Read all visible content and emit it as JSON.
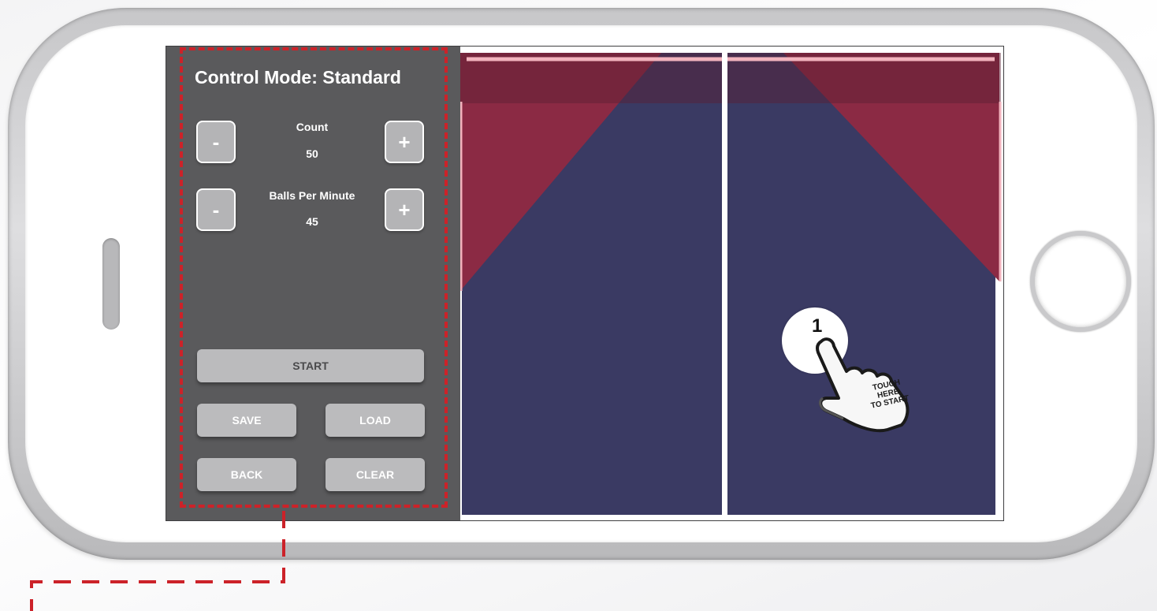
{
  "panel": {
    "mode_title": "Control Mode: Standard",
    "count": {
      "label": "Count",
      "value": "50",
      "minus": "-",
      "plus": "+"
    },
    "balls_per_minute": {
      "label": "Balls Per Minute",
      "value": "45",
      "minus": "-",
      "plus": "+"
    },
    "buttons": {
      "start": "START",
      "save": "SAVE",
      "load": "LOAD",
      "back": "BACK",
      "clear": "CLEAR"
    }
  },
  "hint": {
    "step": "1",
    "line1": "TOUCH",
    "line2": "HERE",
    "line3": "TO START"
  },
  "colors": {
    "table_blue": "#3a3a63",
    "zone_red": "#8b2a44",
    "callout_red": "#cc2229",
    "panel_gray": "#5a5a5c"
  },
  "icons": [
    "hand-pointer-icon",
    "minus-icon",
    "plus-icon"
  ]
}
